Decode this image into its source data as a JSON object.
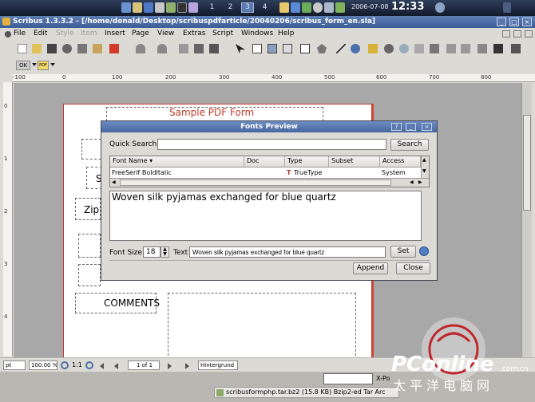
{
  "taskbar": {
    "workspaces": [
      "1",
      "2",
      "3",
      "4"
    ],
    "active_workspace": "3",
    "date": "2006-07-08",
    "time": "12:33"
  },
  "window": {
    "title": "Scribus 1.3.3.2 - [/home/donald/Desktop/scribuspdfarticle/20040206/scribus_form_en.sla]",
    "menu": [
      "File",
      "Edit",
      "Style",
      "Item",
      "Insert",
      "Page",
      "View",
      "Extras",
      "Script",
      "Windows",
      "Help"
    ],
    "menu_disabled": [
      "Style",
      "Item"
    ]
  },
  "toolbar3": {
    "ok_label": "OK",
    "pdf_label": "PDF"
  },
  "ruler": {
    "h_ticks": [
      "-100",
      "0",
      "100",
      "200",
      "300",
      "400",
      "500",
      "600",
      "700",
      "800"
    ],
    "v_ticks": [
      "0",
      "1",
      "2",
      "3",
      "4"
    ]
  },
  "page": {
    "title": "Sample PDF Form",
    "partial_s": "S",
    "partial_zip": "Zip",
    "comments_label": "COMMENTS"
  },
  "statusbar": {
    "unit": "pt",
    "zoom": "100.00 %",
    "ratio": "1:1",
    "page_of": "1 of 1",
    "layer": "Hintergrund"
  },
  "lower": {
    "xpos_label": "X-Po",
    "download_item": "scribusformphp.tar.bz2 (15.8 KB)  Bzip2-ed Tar Arc"
  },
  "watermark": {
    "brand": "PConline",
    "domain": ".com.cn",
    "chinese": "太平洋电脑网"
  },
  "dialog": {
    "title": "Fonts Preview",
    "quick_search_label": "Quick Search:",
    "quick_search_value": "",
    "search_button": "Search",
    "columns": [
      "Font Name",
      "Doc",
      "Type",
      "Subset",
      "Access"
    ],
    "rows": [
      {
        "font_name": "FreeSerif BoldItalic",
        "doc": "",
        "type": "TrueType",
        "subset": "",
        "access": "System"
      }
    ],
    "preview_text": "Woven silk pyjamas exchanged for blue quartz",
    "font_size_label": "Font Size:",
    "font_size_value": "18",
    "text_label": "Text",
    "text_value": "Woven silk pyjamas exchanged for blue quartz",
    "set_button": "Set",
    "append_button": "Append",
    "close_button": "Close"
  },
  "colors": {
    "titlebar": "#3b5d98",
    "page_title": "#c0392b",
    "canvas": "#a8a8a8",
    "watermark_accent": "#c0272d"
  }
}
